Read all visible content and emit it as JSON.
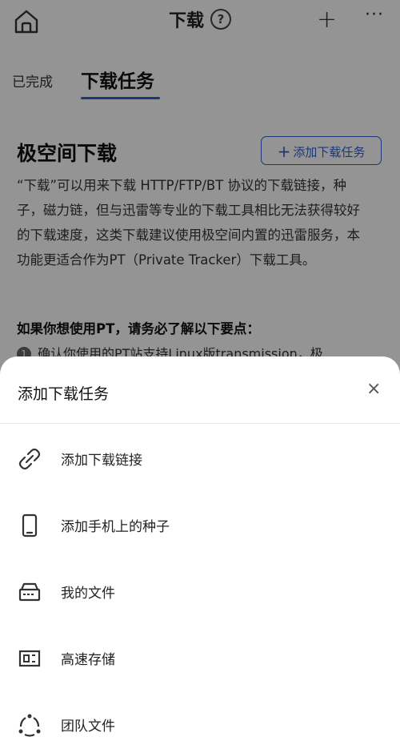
{
  "header": {
    "title": "下载",
    "help_symbol": "?",
    "add_symbol": "+",
    "more_symbol": "···"
  },
  "tabs": [
    {
      "label": "已完成"
    },
    {
      "label": "下载任务"
    }
  ],
  "content": {
    "section_title": "极空间下载",
    "add_task_label": "添加下载任务",
    "description": "“下载”可以用来下载 HTTP/FTP/BT 协议的下载链接，种子，磁力链，但与迅雷等专业的下载工具相比无法获得较好的下载速度，这类下载建议使用极空间内置的迅雷服务，本功能更适合作为PT（Private Tracker）下载工具。",
    "requirements_title": "如果你想使用PT，请务必了解以下要点：",
    "requirement_1_number": "1",
    "requirement_1_text": "确认你使用的PT站支持Linux版transmission，极"
  },
  "sheet": {
    "title": "添加下载任务",
    "close_symbol": "×",
    "options": [
      {
        "label": "添加下载链接",
        "icon": "link-icon"
      },
      {
        "label": "添加手机上的种子",
        "icon": "phone-icon"
      },
      {
        "label": "我的文件",
        "icon": "storage-drive-icon"
      },
      {
        "label": "高速存储",
        "icon": "fast-storage-icon"
      },
      {
        "label": "团队文件",
        "icon": "team-icon"
      }
    ]
  },
  "colors": {
    "accent": "#2f5fd1",
    "overlay": "rgba(0,0,0,0.42)"
  }
}
